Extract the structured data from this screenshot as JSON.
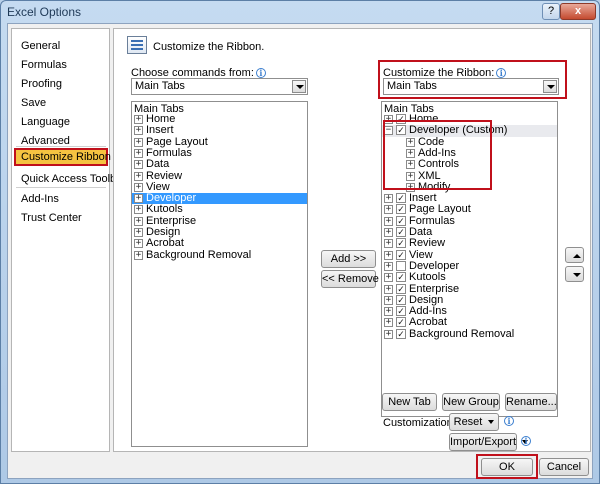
{
  "window": {
    "title": "Excel Options",
    "help_label": "?",
    "close_label": "x"
  },
  "nav": {
    "items": [
      {
        "label": "General"
      },
      {
        "label": "Formulas"
      },
      {
        "label": "Proofing"
      },
      {
        "label": "Save"
      },
      {
        "label": "Language"
      },
      {
        "label": "Advanced"
      },
      {
        "label": "Customize Ribbon",
        "selected": true
      },
      {
        "label": "Quick Access Toolbar"
      },
      {
        "label": "Add-Ins"
      },
      {
        "label": "Trust Center"
      }
    ]
  },
  "header": {
    "title": "Customize the Ribbon."
  },
  "left": {
    "choose_label": "Choose commands from:",
    "choose_value": "Main Tabs",
    "list_header": "Main Tabs",
    "items": [
      {
        "label": "Home"
      },
      {
        "label": "Insert"
      },
      {
        "label": "Page Layout"
      },
      {
        "label": "Formulas"
      },
      {
        "label": "Data"
      },
      {
        "label": "Review"
      },
      {
        "label": "View"
      },
      {
        "label": "Developer",
        "selected": true
      },
      {
        "label": "Kutools"
      },
      {
        "label": "Enterprise"
      },
      {
        "label": "Design"
      },
      {
        "label": "Acrobat"
      },
      {
        "label": "Background Removal"
      }
    ]
  },
  "middle": {
    "add_label": "Add >>",
    "remove_label": "<< Remove"
  },
  "right": {
    "customize_label": "Customize the Ribbon:",
    "customize_value": "Main Tabs",
    "list_header": "Main Tabs",
    "items": [
      {
        "label": "Home",
        "checked": true
      },
      {
        "label": "Developer (Custom)",
        "checked": true,
        "expanded": true
      },
      {
        "label": "Code",
        "child": true
      },
      {
        "label": "Add-Ins",
        "child": true
      },
      {
        "label": "Controls",
        "child": true
      },
      {
        "label": "XML",
        "child": true
      },
      {
        "label": "Modify",
        "child": true
      },
      {
        "label": "Insert",
        "checked": true
      },
      {
        "label": "Page Layout",
        "checked": true
      },
      {
        "label": "Formulas",
        "checked": true
      },
      {
        "label": "Data",
        "checked": true
      },
      {
        "label": "Review",
        "checked": true
      },
      {
        "label": "View",
        "checked": true
      },
      {
        "label": "Developer",
        "checked": false
      },
      {
        "label": "Kutools",
        "checked": true
      },
      {
        "label": "Enterprise",
        "checked": true
      },
      {
        "label": "Design",
        "checked": true
      },
      {
        "label": "Add-Ins",
        "checked": true
      },
      {
        "label": "Acrobat",
        "checked": true
      },
      {
        "label": "Background Removal",
        "checked": true
      }
    ],
    "new_tab_label": "New Tab",
    "new_group_label": "New Group",
    "rename_label": "Rename...",
    "customizations_label": "Customizations:",
    "reset_label": "Reset",
    "import_export_label": "Import/Export"
  },
  "footer": {
    "ok_label": "OK",
    "cancel_label": "Cancel"
  },
  "icons": {
    "info": "i",
    "check": "✓",
    "plus": "+",
    "minus": "−"
  },
  "colors": {
    "selection_blue": "#3399ff",
    "highlight_red": "#c0101b",
    "nav_selected": "#f5c341"
  }
}
